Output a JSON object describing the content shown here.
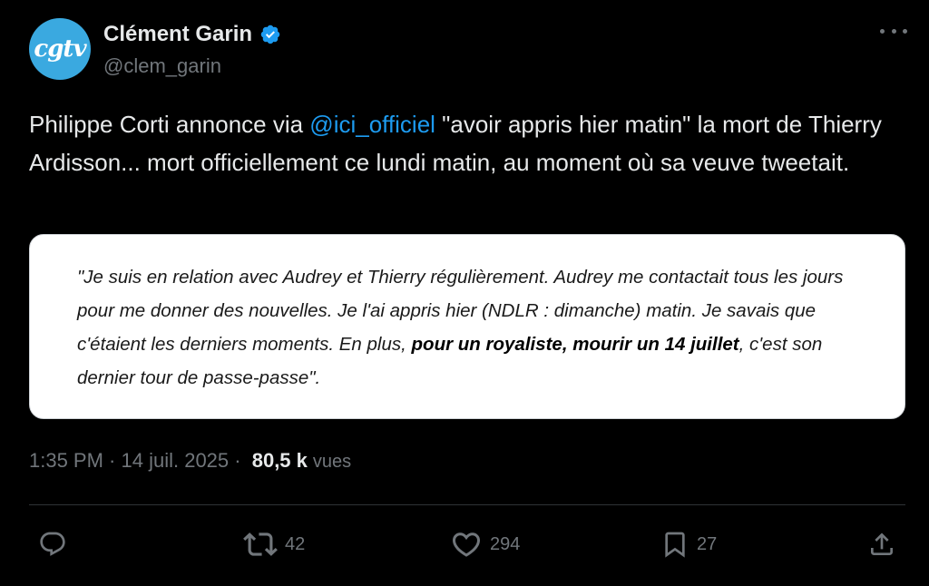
{
  "author": {
    "avatar_text": "cgtv",
    "name": "Clément Garin",
    "handle": "@clem_garin",
    "verified": true
  },
  "tweet": {
    "text_before": "Philippe Corti annonce via ",
    "mention": "@ici_officiel",
    "text_after": " \"avoir appris hier matin\" la mort de Thierry Ardisson... mort officiellement ce lundi matin, au moment où sa veuve tweetait."
  },
  "quote": {
    "part1": "\"Je suis en relation avec Audrey et Thierry régulièrement. Audrey me contactait tous les jours pour me donner des nouvelles. Je l'ai appris hier (NDLR : dimanche) matin. Je savais que c'étaient les derniers moments. En plus, ",
    "bold": "pour un royaliste, mourir un 14 juillet",
    "part2": ", c'est son dernier tour de passe-passe\"."
  },
  "meta": {
    "time": "1:35 PM",
    "separator": " · ",
    "date": "14 juil. 2025",
    "separator2": " · ",
    "views_count": "80,5 k",
    "views_label": "vues"
  },
  "actions": {
    "replies": "",
    "reposts": "42",
    "likes": "294",
    "bookmarks": "27"
  },
  "colors": {
    "background": "#000000",
    "text": "#e7e9ea",
    "secondary": "#71767b",
    "link": "#1d9bf0",
    "avatar": "#3aa9e0",
    "verified": "#1d9bf0"
  }
}
